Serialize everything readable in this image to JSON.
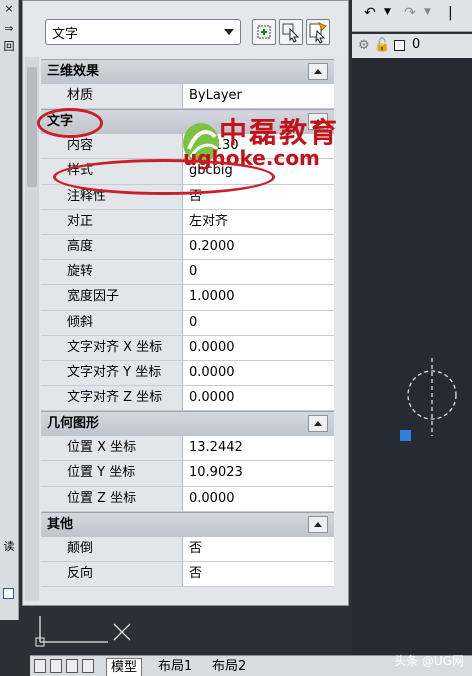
{
  "left_strip": {
    "close": "×",
    "marker": "⇒",
    "box": "回",
    "vert_text": "读"
  },
  "palette": {
    "selector": "文字",
    "sections": [
      {
        "title": "三维效果",
        "rows": [
          {
            "k": "材质",
            "v": "ByLayer"
          }
        ]
      },
      {
        "title": "文字",
        "rows": [
          {
            "k": "内容",
            "v": "%%130"
          },
          {
            "k": "样式",
            "v": "gbcbig"
          },
          {
            "k": "注释性",
            "v": "否"
          },
          {
            "k": "对正",
            "v": "左对齐"
          },
          {
            "k": "高度",
            "v": "0.2000"
          },
          {
            "k": "旋转",
            "v": "0"
          },
          {
            "k": "宽度因子",
            "v": "1.0000"
          },
          {
            "k": "倾斜",
            "v": "0"
          },
          {
            "k": "文字对齐 X 坐标",
            "v": "0.0000"
          },
          {
            "k": "文字对齐 Y 坐标",
            "v": "0.0000"
          },
          {
            "k": "文字对齐 Z 坐标",
            "v": "0.0000"
          }
        ]
      },
      {
        "title": "几何图形",
        "rows": [
          {
            "k": "位置 X 坐标",
            "v": "13.2442"
          },
          {
            "k": "位置 Y 坐标",
            "v": "10.9023"
          },
          {
            "k": "位置 Z 坐标",
            "v": "0.0000"
          }
        ]
      },
      {
        "title": "其他",
        "rows": [
          {
            "k": "颠倒",
            "v": "否"
          },
          {
            "k": "反向",
            "v": "否"
          }
        ]
      }
    ]
  },
  "right_toolbar": {
    "layer": "0"
  },
  "tabs": [
    "模型",
    "布局1",
    "布局2"
  ],
  "watermark": {
    "title": "中磊教育",
    "url": "ughoke.com"
  },
  "credit": "头条 @UG网",
  "colors": {
    "highlight": "#c8202a",
    "canvas": "#262b33",
    "selected_grip": "#2f7fdc"
  }
}
